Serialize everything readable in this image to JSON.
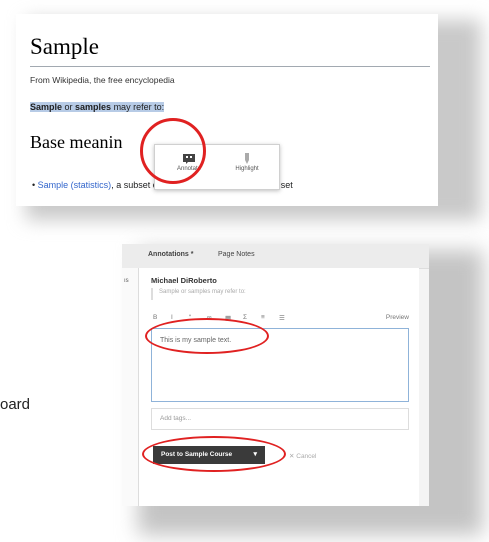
{
  "wiki": {
    "title": "Sample",
    "tagline": "From Wikipedia, the free encyclopedia",
    "line_part1": "Sample",
    "line_part2": " or ",
    "line_part3": "samples",
    "line_part4": " may refer to:",
    "section_heading": "Base meanin",
    "bullet_link": "Sample (statistics)",
    "bullet_text": ", a subset of a population - Complete data set"
  },
  "popover": {
    "annotate_label": "Annotate",
    "highlight_label": "Highlight",
    "annotate_icon": "annotate-icon",
    "highlight_icon": "highlight-icon"
  },
  "hypothesis": {
    "tabs": [
      "Annotations *",
      "Page Notes"
    ],
    "left_cut_text": "ıs",
    "user": "Michael DiRoberto",
    "quote": "Sample or samples may refer to:",
    "toolbar": [
      "B",
      "I",
      "“",
      "∞",
      "▦",
      "Σ",
      "≡",
      "☰"
    ],
    "preview_label": "Preview",
    "editor_text": "This is my sample text.",
    "tags_placeholder": "Add tags...",
    "post_label": "Post to Sample Course",
    "post_caret": "▾",
    "cancel_label": "✕ Cancel"
  },
  "side": {
    "text": "oard"
  },
  "colors": {
    "annotation_ring": "#e02121",
    "link": "#3366cc",
    "highlight": "#b7cbe6",
    "post_button": "#3a3a3a"
  }
}
